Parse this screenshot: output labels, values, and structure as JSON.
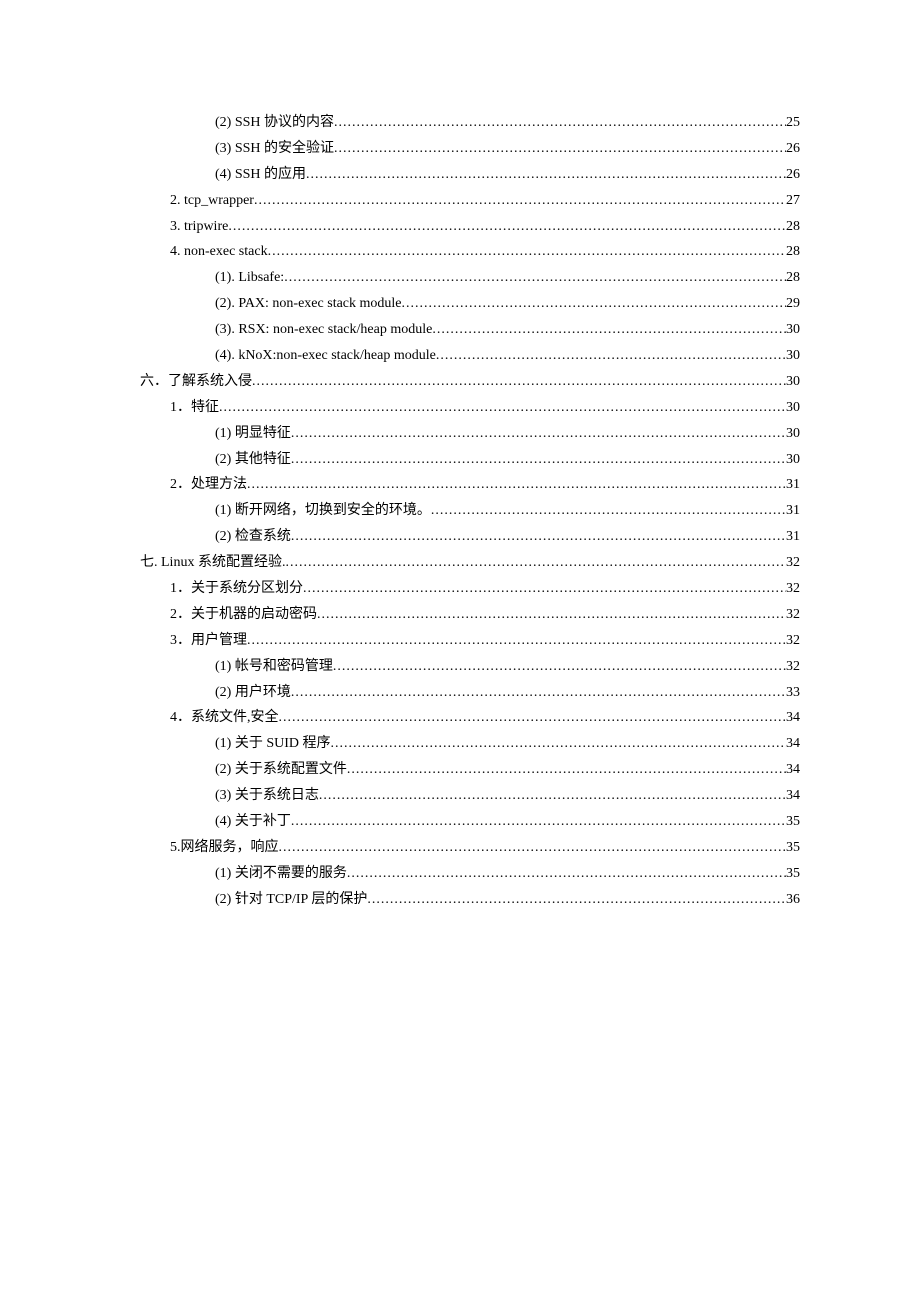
{
  "toc": [
    {
      "level": 2,
      "title": "(2) SSH 协议的内容",
      "page": "25"
    },
    {
      "level": 2,
      "title": "(3) SSH 的安全验证",
      "page": "26"
    },
    {
      "level": 2,
      "title": "(4) SSH 的应用",
      "page": "26"
    },
    {
      "level": 1,
      "title": "2. tcp_wrapper",
      "page": "27"
    },
    {
      "level": 1,
      "title": "3. tripwire",
      "page": "28"
    },
    {
      "level": 1,
      "title": "4. non-exec stack",
      "page": "28"
    },
    {
      "level": 2,
      "title": "(1). Libsafe:",
      "page": "28"
    },
    {
      "level": 2,
      "title": "(2). PAX: non-exec stack module",
      "page": "29"
    },
    {
      "level": 2,
      "title": "(3). RSX: non-exec stack/heap module ",
      "page": "30"
    },
    {
      "level": 2,
      "title": "(4). kNoX:non-exec stack/heap module ",
      "page": "30"
    },
    {
      "level": 0,
      "title": "六．了解系统入侵",
      "page": "30"
    },
    {
      "level": 1,
      "title": "1．特征",
      "page": "30"
    },
    {
      "level": 2,
      "title": "(1) 明显特征",
      "page": "30"
    },
    {
      "level": 2,
      "title": "(2) 其他特征",
      "page": "30"
    },
    {
      "level": 1,
      "title": "2．处理方法",
      "page": "31"
    },
    {
      "level": 2,
      "title": "(1) 断开网络，切换到安全的环境。",
      "page": "31"
    },
    {
      "level": 2,
      "title": "(2) 检查系统",
      "page": "31"
    },
    {
      "level": 0,
      "title": "七. Linux 系统配置经验.",
      "page": "32"
    },
    {
      "level": 1,
      "title": "1．关于系统分区划分",
      "page": "32"
    },
    {
      "level": 1,
      "title": "2．关于机器的启动密码",
      "page": "32"
    },
    {
      "level": 1,
      "title": "3．用户管理",
      "page": "32"
    },
    {
      "level": 2,
      "title": "(1) 帐号和密码管理",
      "page": "32"
    },
    {
      "level": 2,
      "title": "(2) 用户环境",
      "page": "33"
    },
    {
      "level": 1,
      "title": "4．系统文件,安全",
      "page": "34"
    },
    {
      "level": 2,
      "title": "(1)   关于 SUID 程序",
      "page": "34"
    },
    {
      "level": 2,
      "title": "(2) 关于系统配置文件",
      "page": "34"
    },
    {
      "level": 2,
      "title": "(3) 关于系统日志",
      "page": "34"
    },
    {
      "level": 2,
      "title": "(4) 关于补丁",
      "page": "35"
    },
    {
      "level": 1,
      "title": "5.网络服务，响应",
      "page": "35"
    },
    {
      "level": 2,
      "title": "(1) 关闭不需要的服务",
      "page": "35"
    },
    {
      "level": 2,
      "title": "(2) 针对 TCP/IP 层的保护",
      "page": "36"
    }
  ]
}
